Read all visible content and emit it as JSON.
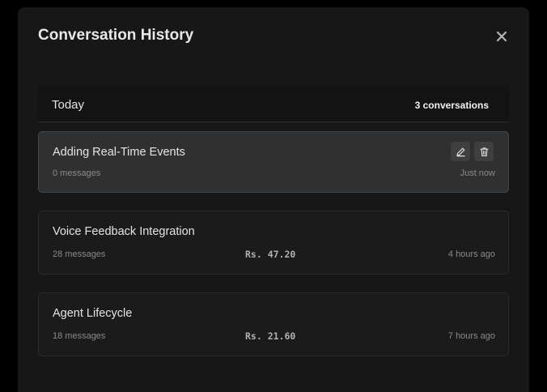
{
  "modal": {
    "title": "Conversation History"
  },
  "group": {
    "title": "Today",
    "count_label": "3 conversations"
  },
  "conversations": [
    {
      "title": "Adding Real-Time Events",
      "messages": "0 messages",
      "cost": "",
      "time": "Just now",
      "active": true
    },
    {
      "title": "Voice Feedback Integration",
      "messages": "28 messages",
      "cost": "Rs. 47.20",
      "time": "4 hours ago",
      "active": false
    },
    {
      "title": "Agent Lifecycle",
      "messages": "18 messages",
      "cost": "Rs. 21.60",
      "time": "7 hours ago",
      "active": false
    }
  ],
  "icons": {
    "close": "close-icon",
    "edit": "pencil-icon",
    "delete": "trash-icon"
  },
  "colors": {
    "background": "#000000",
    "modal": "#171717",
    "active_card": "#303030",
    "text": "#e4e4e4",
    "muted": "#8a8a8a"
  }
}
